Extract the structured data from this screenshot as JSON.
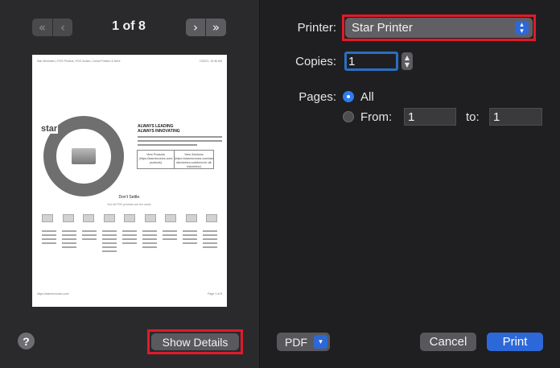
{
  "preview": {
    "page_indicator": "1 of 8",
    "nav_first": "«",
    "nav_prev": "‹",
    "nav_next": "›",
    "nav_last": "»",
    "thumbnail": {
      "header_left": "Star Minimizer | POS Printers, POS Scales, Check Printers & More",
      "header_right": "7/30/21, 10:36 AM",
      "logo": "star",
      "headline": "ALWAYS LEADING\nALWAYS INNOVATING",
      "table_col1": "View Products (https://starmicronics.com/ products)",
      "table_col2": "View Solutions (https://starmicronics.com/star microtonics-solutions-for-all-industries/)",
      "settle": "Don't Settle.",
      "subline": "Not all POS products are the same.",
      "footer_left": "https://starmicronics.com/",
      "footer_right": "Page 1 of 8"
    },
    "help_label": "?",
    "show_details_label": "Show Details"
  },
  "settings": {
    "printer_label": "Printer:",
    "printer_value": "Star Printer",
    "copies_label": "Copies:",
    "copies_value": "1",
    "pages_label": "Pages:",
    "pages_all": "All",
    "pages_from": "From:",
    "from_value": "1",
    "to_label": "to:",
    "to_value": "1",
    "pages_selected": "All"
  },
  "footer": {
    "pdf_label": "PDF",
    "cancel_label": "Cancel",
    "print_label": "Print"
  },
  "colors": {
    "accent": "#2d68d8",
    "highlight_red": "#e01a2b",
    "background": "#1f1f21"
  }
}
